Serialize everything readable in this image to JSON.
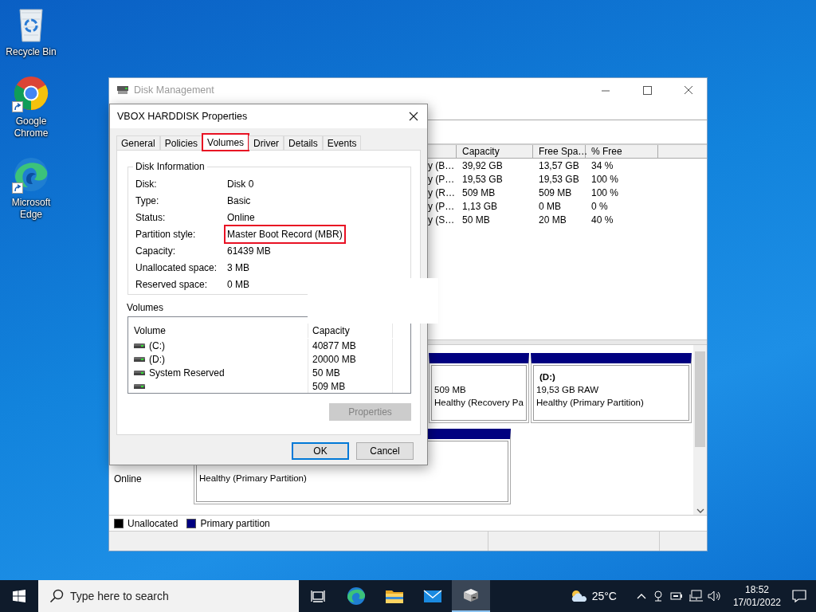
{
  "desktop_icons": [
    {
      "kind": "recycle-bin",
      "label": "Recycle Bin",
      "shortcut": false
    },
    {
      "kind": "chrome",
      "label": "Google Chrome",
      "shortcut": true
    },
    {
      "kind": "edge",
      "label": "Microsoft Edge",
      "shortcut": true
    }
  ],
  "disk_management": {
    "title": "Disk Management",
    "active": false,
    "table": {
      "columns": [
        "",
        "Capacity",
        "Free Spa…",
        "% Free"
      ],
      "rows": [
        [
          "y (B…",
          "39,92 GB",
          "13,57 GB",
          "34 %"
        ],
        [
          "y (P…",
          "19,53 GB",
          "19,53 GB",
          "100 %"
        ],
        [
          "y (R…",
          "509 MB",
          "509 MB",
          "100 %"
        ],
        [
          "y (P…",
          "1,13 GB",
          "0 MB",
          "0 %"
        ],
        [
          "y (S…",
          "50 MB",
          "20 MB",
          "40 %"
        ]
      ]
    },
    "disks": [
      {
        "partitions": [
          {
            "size": "509 MB",
            "status": "Healthy (Recovery Pa"
          },
          {
            "name": "(D:)",
            "size": "19,53 GB RAW",
            "status": "Healthy (Primary Partition)"
          }
        ]
      },
      {
        "info": [
          "Online"
        ],
        "partitions": [
          {
            "status": "Healthy (Primary Partition)"
          }
        ]
      }
    ],
    "legend": [
      {
        "label": "Unallocated",
        "color": "#000000"
      },
      {
        "label": "Primary partition",
        "color": "#000080"
      }
    ]
  },
  "dialog": {
    "title": "VBOX HARDDISK Properties",
    "tabs": [
      {
        "label": "General",
        "selected": false,
        "highlighted": false
      },
      {
        "label": "Policies",
        "selected": false,
        "highlighted": false
      },
      {
        "label": "Volumes",
        "selected": true,
        "highlighted": true
      },
      {
        "label": "Driver",
        "selected": false,
        "highlighted": false
      },
      {
        "label": "Details",
        "selected": false,
        "highlighted": false
      },
      {
        "label": "Events",
        "selected": false,
        "highlighted": false
      }
    ],
    "disk_information": {
      "title": "Disk Information",
      "fields": [
        {
          "label": "Disk:",
          "value": "Disk 0",
          "highlighted": false
        },
        {
          "label": "Type:",
          "value": "Basic",
          "highlighted": false
        },
        {
          "label": "Status:",
          "value": "Online",
          "highlighted": false
        },
        {
          "label": "Partition style:",
          "value": "Master Boot Record (MBR)",
          "highlighted": true
        },
        {
          "label": "Capacity:",
          "value": "61439 MB",
          "highlighted": false
        },
        {
          "label": "Unallocated space:",
          "value": "3 MB",
          "highlighted": false
        },
        {
          "label": "Reserved space:",
          "value": "0 MB",
          "highlighted": false
        }
      ]
    },
    "volumes": {
      "title": "Volumes",
      "columns": [
        "Volume",
        "Capacity"
      ],
      "rows": [
        {
          "volume": "(C:)",
          "capacity": "40877 MB"
        },
        {
          "volume": "(D:)",
          "capacity": "20000 MB"
        },
        {
          "volume": "System Reserved",
          "capacity": "50 MB"
        },
        {
          "capacity": "509 MB"
        }
      ]
    },
    "properties_button": {
      "label": "Properties",
      "disabled": true
    },
    "buttons": [
      {
        "label": "OK",
        "default": true
      },
      {
        "label": "Cancel",
        "default": false
      }
    ]
  },
  "taskbar": {
    "search": {
      "placeholder": "Type here to search"
    },
    "apps": [
      {
        "kind": "task-view",
        "active": false
      },
      {
        "kind": "edge",
        "active": false
      },
      {
        "kind": "explorer",
        "active": false
      },
      {
        "kind": "mail",
        "active": false
      },
      {
        "kind": "disk-management",
        "active": true
      }
    ],
    "weather": "25°C",
    "time": "18:52",
    "date": "17/01/2022"
  }
}
